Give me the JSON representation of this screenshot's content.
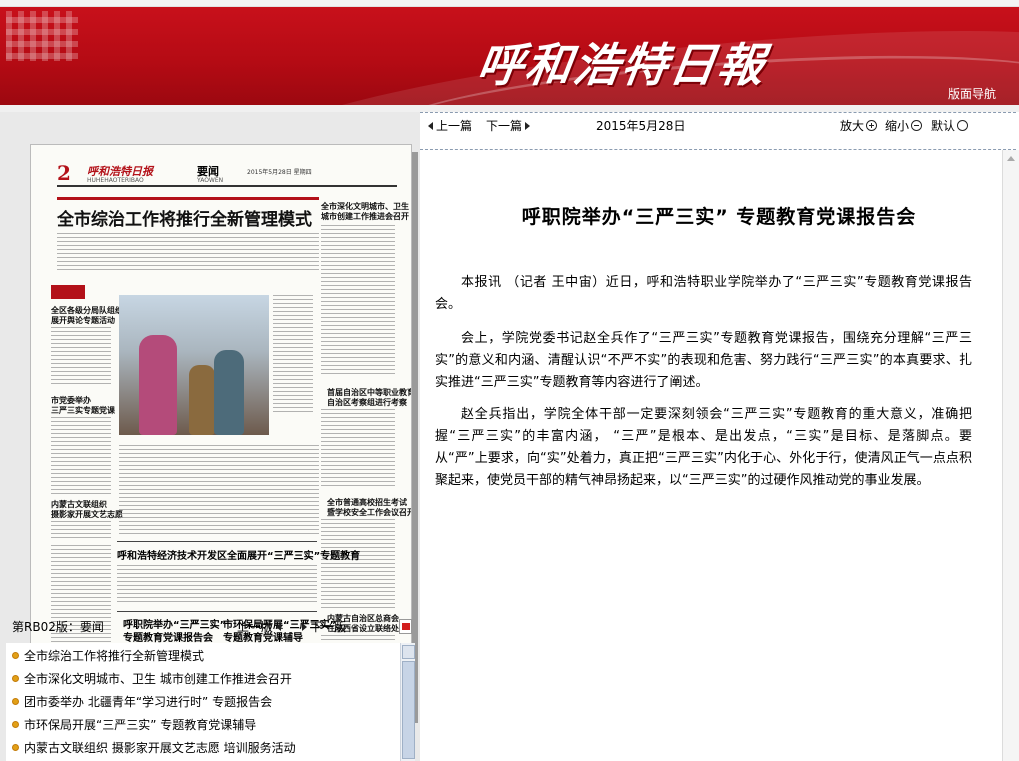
{
  "masthead": {
    "logo_text": "呼和浩特日報",
    "nav_label": "版面导航"
  },
  "paper": {
    "page_number": "2",
    "paper_name": "呼和浩特日报",
    "paper_name_en": "HUHEHAOTERIBAO",
    "section": "要闻",
    "section_en": "YAOWEN",
    "date_line": "2015年5月28日 星期四",
    "headline": "全市综治工作将推行全新管理模式",
    "side_head_1": "全市深化文明城市、卫生",
    "side_head_2": "城市创建工作推进会召开",
    "left_head_1": "全区各级分局队组织",
    "left_head_2": "展开舆论专题活动",
    "left_head_3": "市党委举办",
    "left_head_4": "三严三实专题党课",
    "left_head_5": "内蒙古文联组织",
    "left_head_6": "摄影家开展文艺志愿",
    "right_head_1": "首届自治区中等职业教育工作",
    "right_head_2": "自治区考察组进行考察",
    "right_head_3": "全市普通高校招生考试",
    "right_head_4": "暨学校安全工作会议召开",
    "mid_head": "呼和浩特经济技术开发区全面展开“三严三实”专题教育",
    "box_head_1a": "呼职院举办“三严三实”",
    "box_head_1b": "专题教育党课报告会",
    "box_head_2a": "市环保局开展“三严三实”",
    "box_head_2b": "专题教育党课辅导",
    "right_head_5": "内蒙古自治区总商会",
    "right_head_6": "在陕西省设立联络处"
  },
  "page_bar": {
    "page_id": "第RB02版：要闻",
    "prev_page": "上一版",
    "next_page": "下一版"
  },
  "article_list": [
    "全市综治工作将推行全新管理模式",
    "全市深化文明城市、卫生 城市创建工作推进会召开",
    "团市委举办 北疆青年“学习进行时” 专题报告会",
    "市环保局开展“三严三实” 专题教育党课辅导",
    "内蒙古文联组织 摄影家开展文艺志愿 培训服务活动"
  ],
  "toolbar": {
    "prev_article": "上一篇",
    "next_article": "下一篇",
    "date": "2015年5月28日",
    "zoom_in": "放大",
    "zoom_out": "缩小",
    "default": "默认"
  },
  "article": {
    "title": "呼职院举办“三严三实”  专题教育党课报告会",
    "paragraphs": [
      "本报讯 （记者 王中宙）近日，呼和浩特职业学院举办了“三严三实”专题教育党课报告会。",
      "会上，学院党委书记赵全兵作了“三严三实”专题教育党课报告，围绕充分理解“三严三实”的意义和内涵、清醒认识“不严不实”的表现和危害、努力践行“三严三实”的本真要求、扎实推进“三严三实”专题教育等内容进行了阐述。",
      "赵全兵指出，学院全体干部一定要深刻领会“三严三实”专题教育的重大意义，准确把握“三严三实”的丰富内涵， “三严”是根本、是出发点，“三实”是目标、是落脚点。要从“严”上要求，向“实”处着力，真正把“三严三实”内化于心、外化于行，使清风正气一点点积聚起来，使党员干部的精气神昂扬起来，以“三严三实”的过硬作风推动党的事业发展。"
    ]
  },
  "colors": {
    "banner_red": "#c8101b",
    "bullet_orange": "#e2a017"
  }
}
